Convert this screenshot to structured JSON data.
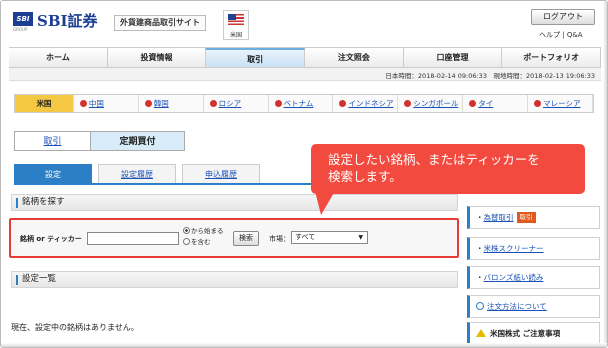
{
  "header": {
    "logo_mark": "SBI",
    "logo_sub": "GROUP",
    "logo_text": "SBI証券",
    "site_name": "外貨建商品取引サイト",
    "region_label": "米国",
    "logout_label": "ログアウト",
    "help_label": "ヘルプ",
    "faq_label": "Q&A"
  },
  "nav": {
    "items": [
      "ホーム",
      "投資情報",
      "取引",
      "注文照会",
      "口座管理",
      "ポートフォリオ"
    ]
  },
  "time": {
    "text": "日本時間：2018-02-14 09:06:33　現地時間：2018-02-13 19:06:33"
  },
  "markets": {
    "items": [
      "米国",
      "中国",
      "韓国",
      "ロシア",
      "ベトナム",
      "インドネシア",
      "シンガポール",
      "タイ",
      "マレーシア"
    ]
  },
  "subtabs": {
    "trade": "取引",
    "regular": "定期買付"
  },
  "lowtabs": {
    "settings": "設定",
    "history": "設定履歴",
    "application": "申込履歴"
  },
  "search_section": {
    "title": "銘柄を探す"
  },
  "search": {
    "label": "銘柄 or ティッカー",
    "value": "",
    "radio_startswith": "から始まる",
    "radio_contains": "を含む",
    "button": "検索",
    "market_label": "市場：",
    "market_value": "すべて"
  },
  "list_section": {
    "title": "設定一覧"
  },
  "empty_message": "現在、設定中の銘柄はありません。",
  "sidebar": {
    "fx": "為替取引",
    "fx_tag": "取引",
    "screener": "米株スクリーナー",
    "balance": "バロンズ紙い読み",
    "order_method": "注文方法について",
    "notice": "米国株式 ご注意事項"
  },
  "callout": {
    "line1": "設定したい銘柄、またはティッカーを",
    "line2": "検索します。"
  },
  "colors": {
    "brand": "#1c3f94",
    "accent": "#2c7fc4",
    "callout": "#f24a3e",
    "active_market": "#f4c842"
  }
}
